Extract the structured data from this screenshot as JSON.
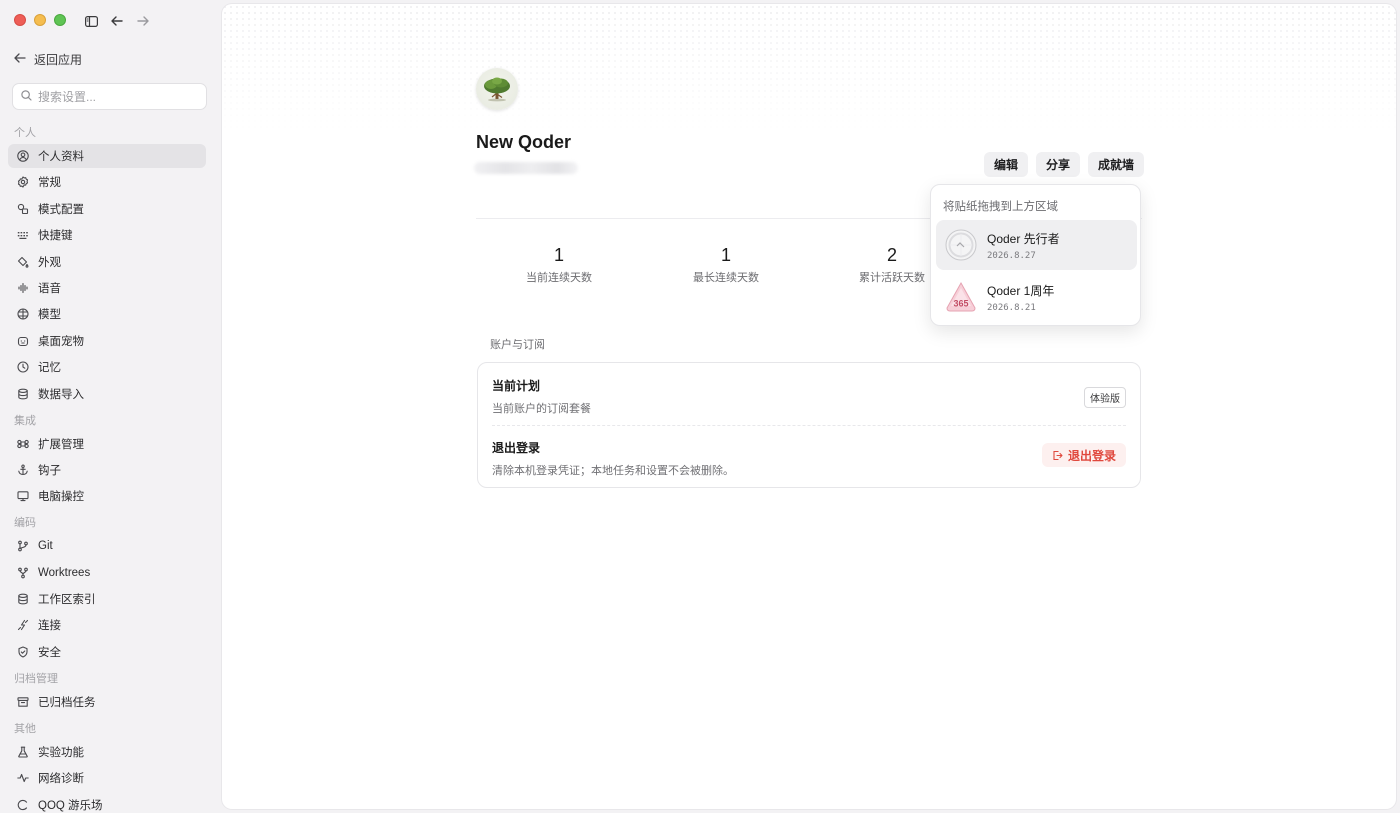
{
  "sidebar": {
    "back_label": "返回应用",
    "search_placeholder": "搜索设置...",
    "groups": [
      {
        "title": "个人",
        "items": [
          {
            "label": "个人资料",
            "icon": "user-circle-icon",
            "active": true
          },
          {
            "label": "常规",
            "icon": "gear-icon"
          },
          {
            "label": "模式配置",
            "icon": "shapes-icon"
          },
          {
            "label": "快捷键",
            "icon": "keyboard-icon"
          },
          {
            "label": "外观",
            "icon": "paint-bucket-icon"
          },
          {
            "label": "语音",
            "icon": "audio-wave-icon"
          },
          {
            "label": "模型",
            "icon": "model-icon"
          },
          {
            "label": "桌面宠物",
            "icon": "pet-icon"
          },
          {
            "label": "记忆",
            "icon": "memory-icon"
          },
          {
            "label": "数据导入",
            "icon": "database-icon"
          }
        ]
      },
      {
        "title": "集成",
        "items": [
          {
            "label": "扩展管理",
            "icon": "command-icon"
          },
          {
            "label": "钩子",
            "icon": "anchor-icon"
          },
          {
            "label": "电脑操控",
            "icon": "monitor-icon"
          }
        ]
      },
      {
        "title": "编码",
        "items": [
          {
            "label": "Git",
            "icon": "git-branch-icon"
          },
          {
            "label": "Worktrees",
            "icon": "git-fork-icon"
          },
          {
            "label": "工作区索引",
            "icon": "database-icon"
          },
          {
            "label": "连接",
            "icon": "plug-icon"
          },
          {
            "label": "安全",
            "icon": "shield-icon"
          }
        ]
      },
      {
        "title": "归档管理",
        "items": [
          {
            "label": "已归档任务",
            "icon": "archive-icon"
          }
        ]
      },
      {
        "title": "其他",
        "items": [
          {
            "label": "实验功能",
            "icon": "flask-icon"
          },
          {
            "label": "网络诊断",
            "icon": "pulse-icon"
          },
          {
            "label": "QOQ 游乐场",
            "icon": "playground-icon"
          }
        ]
      }
    ]
  },
  "profile": {
    "name": "New Qoder",
    "avatar_icon": "tree-icon",
    "actions": {
      "edit": "编辑",
      "share": "分享",
      "achievements": "成就墙"
    }
  },
  "stats": [
    {
      "value": "1",
      "label": "当前连续天数"
    },
    {
      "value": "1",
      "label": "最长连续天数"
    },
    {
      "value": "2",
      "label": "累计活跃天数"
    }
  ],
  "account": {
    "section_title": "账户与订阅",
    "plan": {
      "title": "当前计划",
      "desc": "当前账户的订阅套餐",
      "badge": "体验版"
    },
    "logout": {
      "title": "退出登录",
      "desc": "清除本机登录凭证；本地任务和设置不会被删除。",
      "button": "退出登录"
    }
  },
  "stickers": {
    "hint": "将贴纸拖拽到上方区域",
    "items": [
      {
        "name": "Qoder 先行者",
        "date": "2026.8.27",
        "icon": "pioneer-medal-icon"
      },
      {
        "name": "Qoder 1周年",
        "date": "2026.8.21",
        "icon": "anniversary-365-icon",
        "badge_text": "365"
      }
    ]
  },
  "colors": {
    "accent_danger": "#e0483d",
    "window_close": "#ee5e57",
    "window_min": "#f5bd4f",
    "window_max": "#5fc454"
  }
}
